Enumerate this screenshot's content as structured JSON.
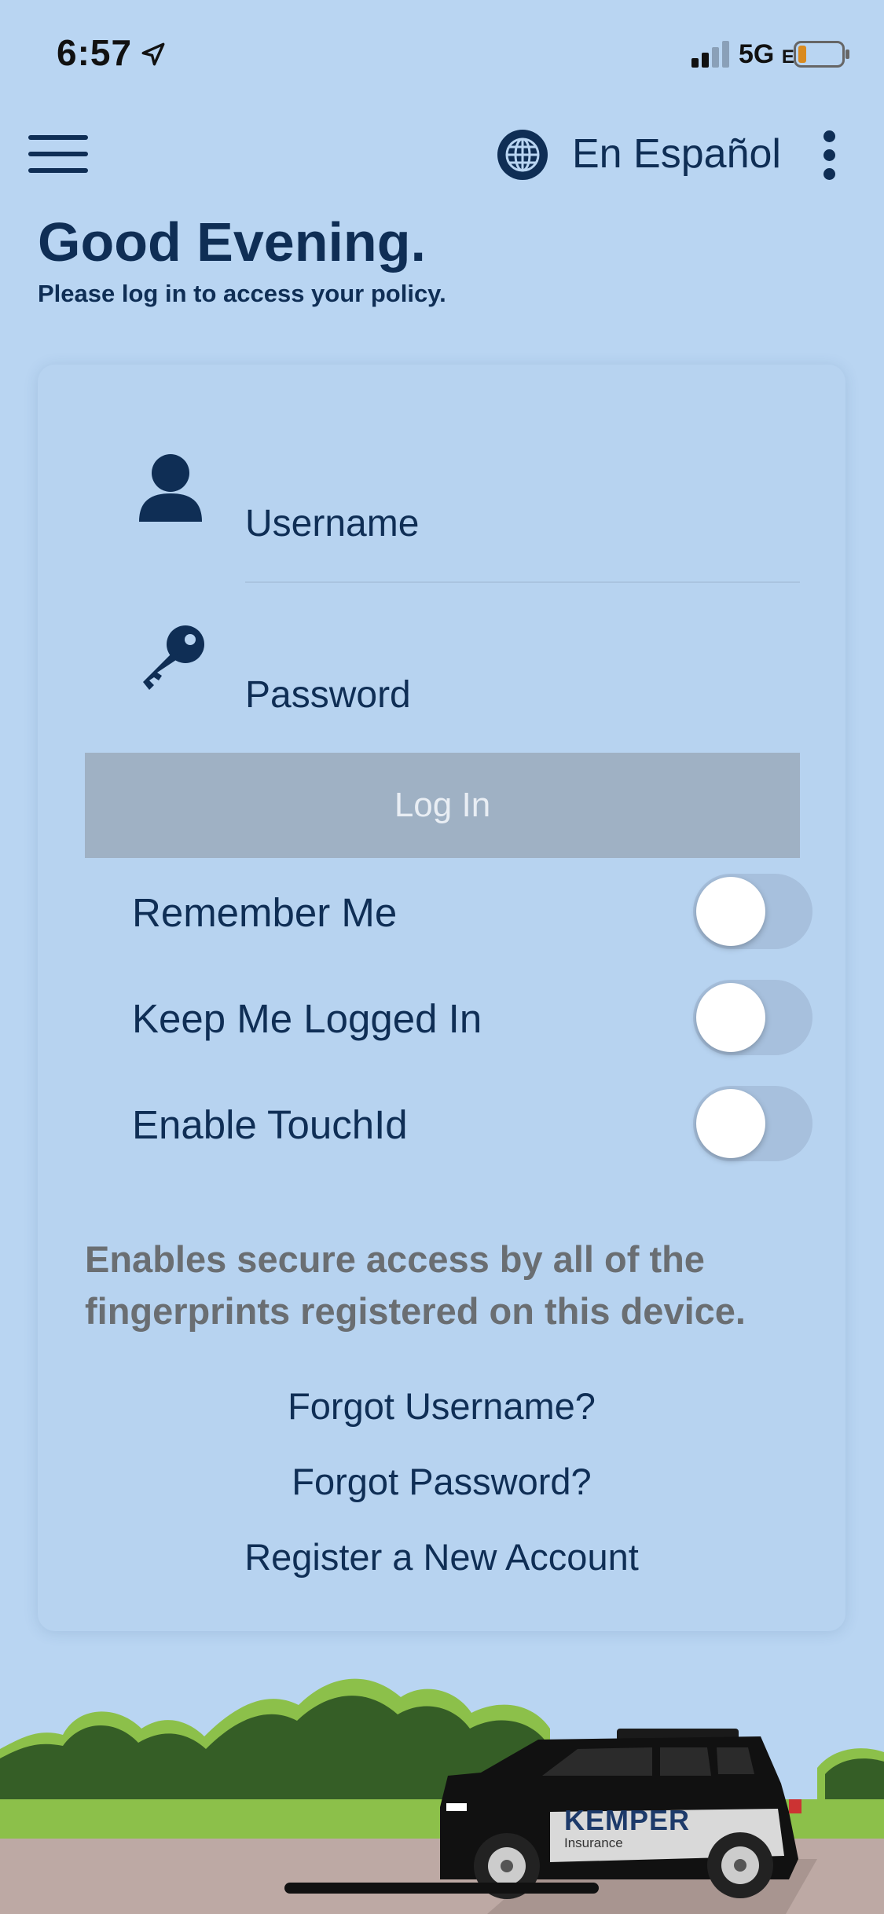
{
  "status_bar": {
    "time": "6:57",
    "network": "5G",
    "network_suffix": "E"
  },
  "header": {
    "language_link": "En Español"
  },
  "greeting": {
    "title": "Good Evening.",
    "subtitle": "Please log in to access your policy."
  },
  "login": {
    "username_placeholder": "Username",
    "password_placeholder": "Password",
    "login_button": "Log In",
    "toggles": [
      {
        "label": "Remember Me",
        "on": false
      },
      {
        "label": "Keep Me Logged In",
        "on": false
      },
      {
        "label": "Enable TouchId",
        "on": false
      }
    ],
    "touch_note": "Enables secure access by all of the fingerprints registered on this device.",
    "links": [
      "Forgot Username?",
      "Forgot Password?",
      "Register a New Account"
    ]
  },
  "brand": {
    "logo": "KEMPER",
    "logo_sub": "Insurance"
  },
  "colors": {
    "background": "#b9d5f2",
    "primary": "#0f2e55",
    "button_disabled": "#9fb1c4",
    "muted_text": "#6a6e72"
  },
  "icons": [
    "location-arrow-icon",
    "signal-icon",
    "battery-icon",
    "hamburger-menu-icon",
    "globe-icon",
    "more-vertical-icon",
    "user-icon",
    "key-icon"
  ]
}
